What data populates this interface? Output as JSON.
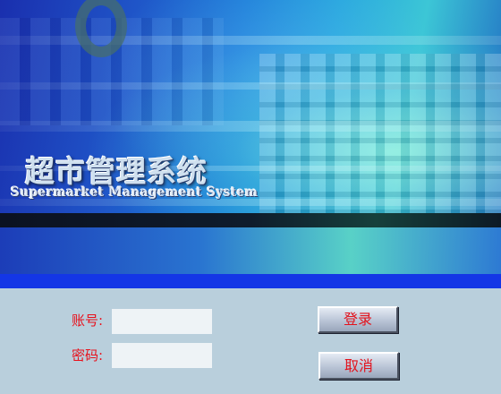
{
  "banner": {
    "title_cn": "超市管理系统",
    "title_en": "Supermarket Management System"
  },
  "login": {
    "username_label": "账号:",
    "username_value": "",
    "password_label": "密码:",
    "password_value": "",
    "login_button": "登录",
    "cancel_button": "取消"
  },
  "colors": {
    "label_text": "#e8101b",
    "button_text": "#e3121c",
    "panel_background": "#b9cfdc",
    "accent_line": "#1436e6"
  }
}
